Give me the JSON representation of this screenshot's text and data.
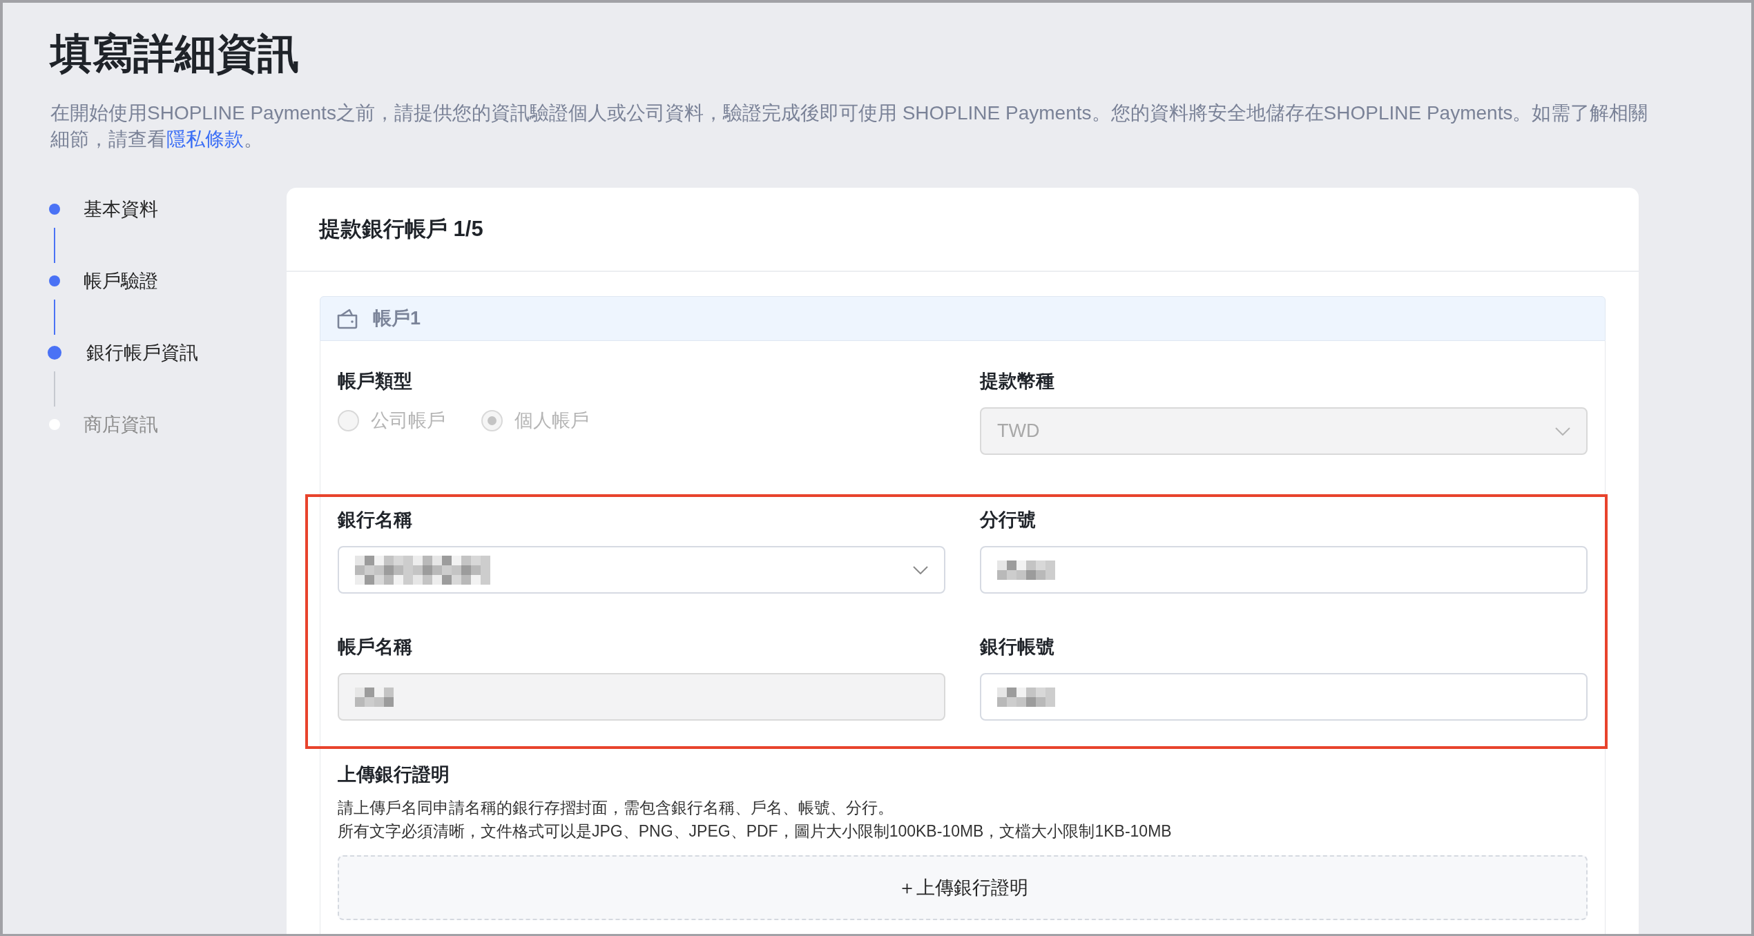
{
  "page": {
    "title": "填寫詳細資訊",
    "description": {
      "text": "在開始使用SHOPLINE Payments之前，請提供您的資訊驗證個人或公司資料，驗證完成後即可使用 SHOPLINE Payments。您的資料將安全地儲存在SHOPLINE Payments。如需了解相關細節，請查看",
      "link": "隱私條款",
      "text_after": "。"
    }
  },
  "steps": [
    {
      "label": "基本資料",
      "completed": true,
      "selected": false
    },
    {
      "label": "帳戶驗證",
      "completed": true,
      "selected": false
    },
    {
      "label": "銀行帳戶資訊",
      "completed": false,
      "selected": true
    },
    {
      "label": "商店資訊",
      "completed": false,
      "selected": false
    }
  ],
  "card": {
    "title": "提款銀行帳戶 1/5",
    "account": {
      "title": "帳戶1",
      "rows": [
        {
          "highlighted": false,
          "fields": [
            {
              "kind": "radio",
              "label": "帳戶類型",
              "disabled": true,
              "options": [
                {
                  "label": "公司帳戶",
                  "selected": false
                },
                {
                  "label": "個人帳戶",
                  "selected": true
                }
              ]
            },
            {
              "kind": "select",
              "label": "提款幣種",
              "value": "TWD",
              "disabled": true
            }
          ]
        },
        {
          "highlighted": true,
          "fields": [
            {
              "kind": "select",
              "label": "銀行名稱",
              "redacted": true,
              "disabled": false
            },
            {
              "kind": "input",
              "label": "分行號",
              "redacted": true,
              "disabled": false
            }
          ]
        },
        {
          "highlighted": true,
          "fields": [
            {
              "kind": "input",
              "label": "帳戶名稱",
              "redacted": true,
              "disabled": true
            },
            {
              "kind": "input",
              "label": "銀行帳號",
              "redacted": true,
              "disabled": false
            }
          ]
        }
      ],
      "upload": {
        "label": "上傳銀行證明",
        "help_lines": [
          "請上傳戶名同申請名稱的銀行存摺封面，需包含銀行名稱、戶名、帳號、分行。",
          "所有文字必須清晰，文件格式可以是JPG、PNG、JPEG、PDF，圖片大小限制100KB-10MB，文檔大小限制1KB-10MB"
        ],
        "button": "＋上傳銀行證明"
      }
    }
  }
}
